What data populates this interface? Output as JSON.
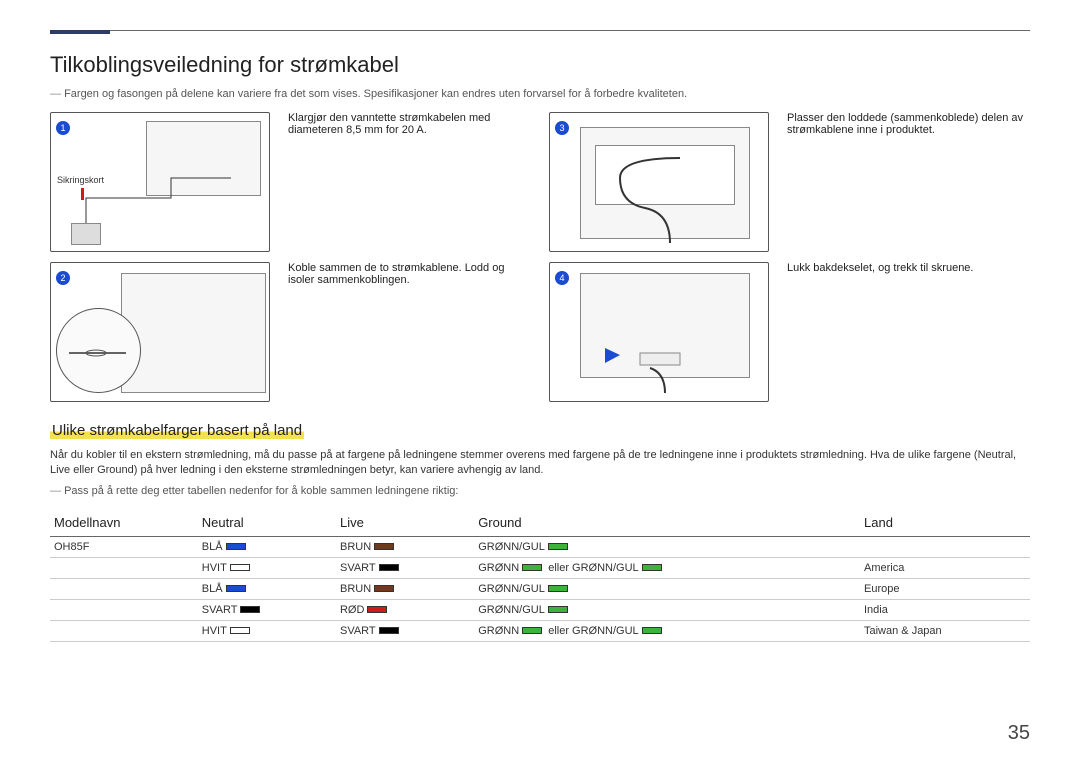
{
  "title": "Tilkoblingsveiledning for strømkabel",
  "top_note": "Fargen og fasongen på delene kan variere fra det som vises. Spesifikasjoner kan endres uten forvarsel for å forbedre kvaliteten.",
  "steps": [
    {
      "num": "1",
      "text": "Klargjør den vanntette strømkabelen med diameteren 8,5 mm for 20 A.",
      "label_in_image": "Sikringskort"
    },
    {
      "num": "2",
      "text": "Koble sammen de to strømkablene. Lodd og isoler sammenkoblingen."
    },
    {
      "num": "3",
      "text": "Plasser den loddede (sammenkoblede) delen av strømkablene inne i produktet."
    },
    {
      "num": "4",
      "text": "Lukk bakdekselet, og trekk til skruene."
    }
  ],
  "section_title": "Ulike strømkabelfarger basert på land",
  "section_para": "Når du kobler til en ekstern strømledning, må du passe på at fargene på ledningene stemmer overens med fargene på de tre ledningene inne i produktets strømledning. Hva de ulike fargene (Neutral, Live eller Ground) på hver ledning i den eksterne strømledningen betyr, kan variere avhengig av land.",
  "section_note": "Pass på å rette deg etter tabellen nedenfor for å koble sammen ledningene riktig:",
  "table": {
    "headers": [
      "Modellnavn",
      "Neutral",
      "Live",
      "Ground",
      "Land"
    ],
    "or_word": "eller",
    "rows": [
      {
        "model": "OH85F",
        "neutral": {
          "label": "BLÅ",
          "cls": "sw-blue"
        },
        "live": {
          "label": "BRUN",
          "cls": "sw-brown"
        },
        "ground": [
          {
            "label": "GRØNN/GUL",
            "cls": "sw-green"
          }
        ],
        "land": ""
      },
      {
        "model": "",
        "neutral": {
          "label": "HVIT",
          "cls": "sw-white"
        },
        "live": {
          "label": "SVART",
          "cls": "sw-black"
        },
        "ground": [
          {
            "label": "GRØNN",
            "cls": "sw-green"
          },
          {
            "label": "GRØNN/GUL",
            "cls": "sw-green"
          }
        ],
        "land": "America"
      },
      {
        "model": "",
        "neutral": {
          "label": "BLÅ",
          "cls": "sw-blue"
        },
        "live": {
          "label": "BRUN",
          "cls": "sw-brown"
        },
        "ground": [
          {
            "label": "GRØNN/GUL",
            "cls": "sw-green"
          }
        ],
        "land": "Europe"
      },
      {
        "model": "",
        "neutral": {
          "label": "SVART",
          "cls": "sw-black"
        },
        "live": {
          "label": "RØD",
          "cls": "sw-red"
        },
        "ground": [
          {
            "label": "GRØNN/GUL",
            "cls": "sw-green"
          }
        ],
        "land": "India"
      },
      {
        "model": "",
        "neutral": {
          "label": "HVIT",
          "cls": "sw-white"
        },
        "live": {
          "label": "SVART",
          "cls": "sw-black"
        },
        "ground": [
          {
            "label": "GRØNN",
            "cls": "sw-green"
          },
          {
            "label": "GRØNN/GUL",
            "cls": "sw-green"
          }
        ],
        "land": "Taiwan & Japan"
      }
    ]
  },
  "page_number": "35"
}
